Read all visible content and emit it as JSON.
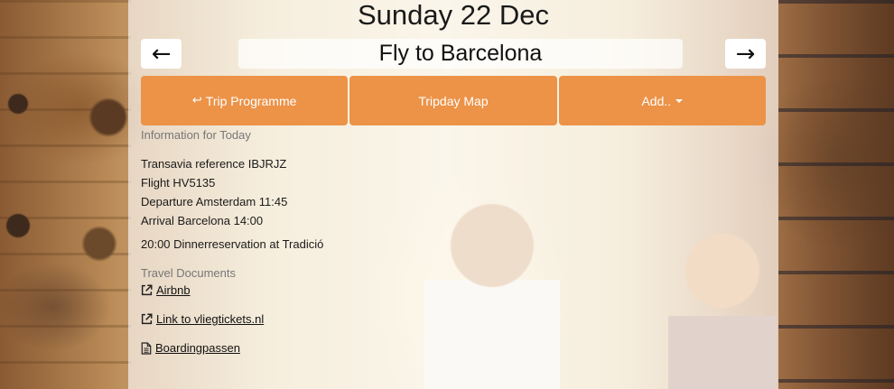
{
  "header": {
    "date": "Sunday 22 Dec",
    "title": "Fly to Barcelona",
    "prev_arrow": "←",
    "next_arrow": "→"
  },
  "actions": {
    "trip_programme_icon": "↩",
    "trip_programme_label": "Trip Programme",
    "tripday_map_label": "Tripday Map",
    "add_label": "Add.."
  },
  "info": {
    "heading": "Information for Today",
    "lines": [
      "Transavia reference IBJRJZ",
      "Flight HV5135",
      "Departure Amsterdam 11:45",
      "Arrival Barcelona 14:00"
    ],
    "dinner": "20:00 Dinnerreservation at Tradició"
  },
  "documents": {
    "heading": "Travel Documents",
    "links": [
      {
        "label": " Airbnb",
        "icon": "external-link-icon"
      },
      {
        "label": " Link to vliegtickets.nl",
        "icon": "external-link-icon"
      },
      {
        "label": " Boardingpassen",
        "icon": "file-icon"
      }
    ]
  },
  "colors": {
    "accent": "#ec9348",
    "panel": "rgba(255,255,255,0.62)"
  }
}
